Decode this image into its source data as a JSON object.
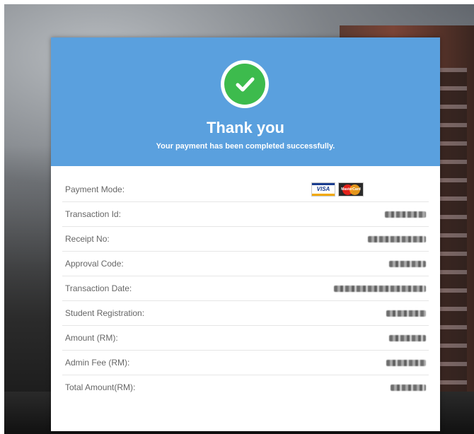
{
  "header": {
    "title": "Thank you",
    "subtitle": "Your payment has been completed successfully.",
    "icon": "check-circle-icon",
    "colors": {
      "banner": "#5aa0de",
      "check": "#3dbb4d"
    }
  },
  "payment_mode": {
    "label": "Payment Mode:",
    "cards": [
      {
        "name": "visa-icon",
        "text": "VISA"
      },
      {
        "name": "mastercard-icon",
        "text": "MasterCard"
      }
    ]
  },
  "rows": [
    {
      "key": "transaction-id",
      "label": "Transaction Id:",
      "value_redacted": true
    },
    {
      "key": "receipt-no",
      "label": "Receipt No:",
      "value_redacted": true
    },
    {
      "key": "approval-code",
      "label": "Approval Code:",
      "value_redacted": true
    },
    {
      "key": "transaction-date",
      "label": "Transaction Date:",
      "value_redacted": true
    },
    {
      "key": "student-registration",
      "label": "Student Registration:",
      "value_redacted": true
    },
    {
      "key": "amount",
      "label": "Amount (RM):",
      "value_redacted": true
    },
    {
      "key": "admin-fee",
      "label": "Admin Fee (RM):",
      "value_redacted": true
    },
    {
      "key": "total-amount",
      "label": "Total Amount(RM):",
      "value_redacted": true
    }
  ]
}
